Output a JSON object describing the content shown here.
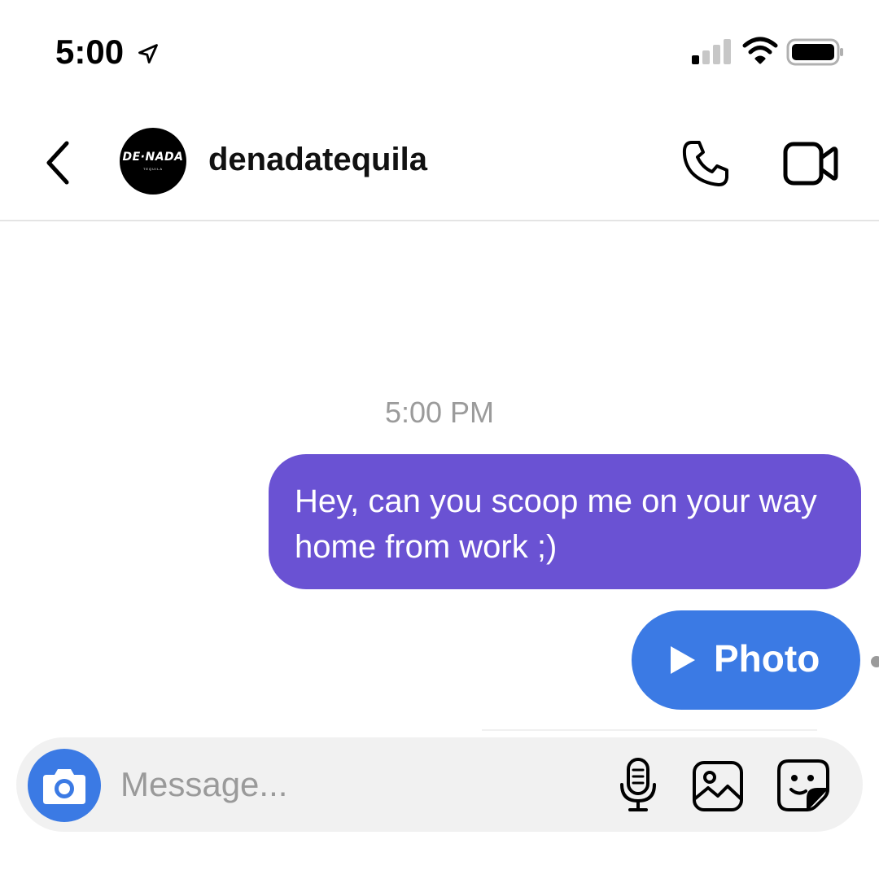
{
  "status_bar": {
    "time": "5:00"
  },
  "header": {
    "username": "denadatequila",
    "avatar_text": "DE·NADA",
    "avatar_subtext": "TEQUILA"
  },
  "thread": {
    "timestamp": "5:00 PM",
    "messages": [
      {
        "type": "text",
        "text": "Hey, can you scoop me on your way home from work ;)"
      },
      {
        "type": "photo",
        "label": "Photo"
      }
    ]
  },
  "composer": {
    "placeholder": "Message..."
  },
  "icons": {
    "status": [
      "location-arrow-icon",
      "signal-icon",
      "wifi-icon",
      "battery-icon"
    ],
    "header": [
      "back-chevron-icon",
      "phone-icon",
      "video-camera-icon"
    ],
    "composer": [
      "camera-icon",
      "microphone-icon",
      "gallery-icon",
      "sticker-icon"
    ]
  },
  "colors": {
    "text_bubble": "#6a52d3",
    "photo_bubble": "#3b7ae4",
    "camera_button": "#3b7ae4",
    "composer_bg": "#f1f1f1",
    "timestamp": "#9b9b9b"
  }
}
